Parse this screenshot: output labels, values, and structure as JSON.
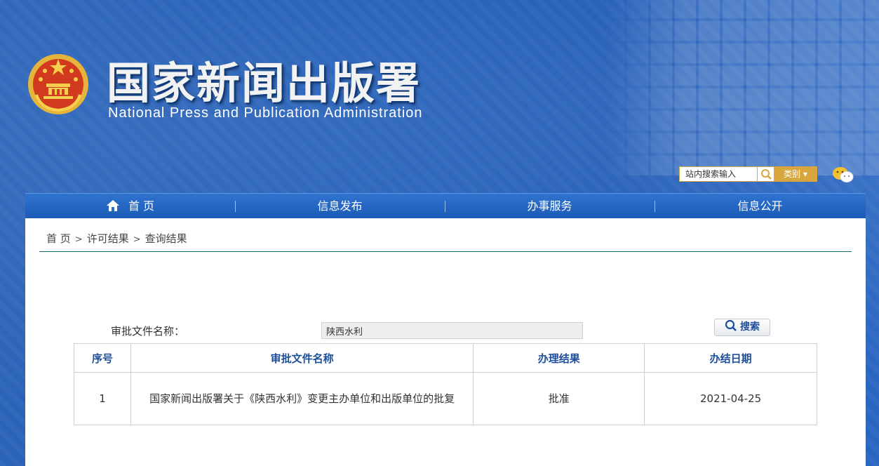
{
  "header": {
    "site_title": "国家新闻出版署",
    "site_subtitle": "National  Press and Publication Administration",
    "search_placeholder": "站内搜索输入",
    "category_label": "类别 ▾"
  },
  "nav": {
    "items": [
      {
        "label": "首 页",
        "icon": "home-icon"
      },
      {
        "label": "信息发布"
      },
      {
        "label": "办事服务"
      },
      {
        "label": "信息公开"
      }
    ]
  },
  "breadcrumb": {
    "items": [
      "首 页",
      "许可结果",
      "查询结果"
    ],
    "separator": ">"
  },
  "filter": {
    "label": "审批文件名称：",
    "value": "陕西水利",
    "search_button": "搜索"
  },
  "table": {
    "columns": [
      "序号",
      "审批文件名称",
      "办理结果",
      "办结日期"
    ],
    "rows": [
      {
        "index": "1",
        "name": "国家新闻出版署关于《陕西水利》变更主办单位和出版单位的批复",
        "result": "批准",
        "date": "2021-04-25"
      }
    ]
  },
  "colors": {
    "header_blue": "#1f5cb8",
    "accent_gold": "#d9a63d",
    "table_header_text": "#1c4e9c",
    "breadcrumb_rule": "#0d6a74"
  }
}
